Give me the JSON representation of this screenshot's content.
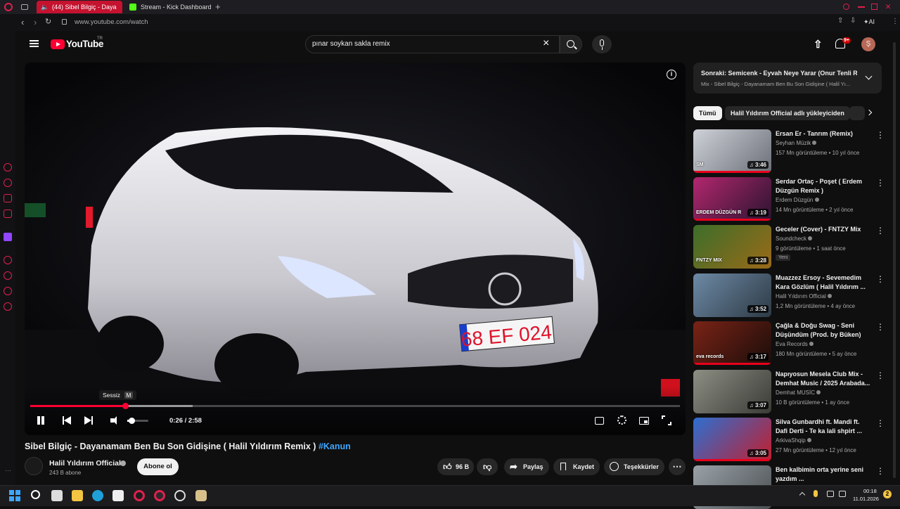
{
  "browser": {
    "tabs": [
      {
        "label": "(44) Sibel Bilgiç - Daya",
        "active": true
      },
      {
        "label": "Stream - Kick Dashboard",
        "active": false
      }
    ],
    "url": "www.youtube.com/watch",
    "ai_label": "AI"
  },
  "header": {
    "logo_text": "YouTube",
    "logo_region": "TR",
    "search_value": "pınar soykan sakla remix",
    "notification_count": "9+",
    "avatar_letter": "Ş"
  },
  "player": {
    "tooltip_label": "Sessiz",
    "tooltip_key": "M",
    "time": "0:26 / 2:58",
    "progress_fraction": 0.146,
    "volume_fraction": 0.2,
    "plate_text": "68 EF 024"
  },
  "video": {
    "title": "Sibel Bilgiç - Dayanamam Ben Bu Son Gidişine ( Halil Yıldırım Remix )",
    "hashtag": "#Kanun",
    "channel": "Halil Yıldırım Official",
    "subscribers": "243 B abone",
    "subscribe_label": "Abone ol",
    "likes": "96 B",
    "share_label": "Paylaş",
    "save_label": "Kaydet",
    "thanks_label": "Teşekkürler"
  },
  "upnext": {
    "title": "Sonraki: Semicenk - Eyvah Neye Yarar (Onur Tenli R...",
    "subtitle": "Mix - Sibel Bilgiç - Dayanamam Ben Bu Son Gidişine ( Halil Yı..."
  },
  "chips": [
    "Tümü",
    "Halil Yıldırım Official adlı yükleyiciden"
  ],
  "recommendations": [
    {
      "title": "Ersan Er - Tanrım (Remix)",
      "channel": "Seyhan Müzik",
      "meta": "157 Mn görüntüleme • 10 yıl önce",
      "duration": "3:46",
      "thumb_overlay": "SM",
      "thumb_colors": [
        "#cfd2d8",
        "#6b6f78"
      ],
      "watched": 1.0
    },
    {
      "title": "Serdar Ortaç - Poşet ( Erdem Düzgün Remix )",
      "channel": "Erdem Düzgün",
      "meta": "14 Mn görüntüleme • 2 yıl önce",
      "duration": "3:19",
      "thumb_overlay": "ERDEM DÜZGÜN R",
      "thumb_colors": [
        "#b3276e",
        "#2a1430"
      ],
      "watched": 1.0
    },
    {
      "title": "Geceler (Cover) - FNTZY Mix",
      "channel": "Soundcheck",
      "meta": "9 görüntüleme • 1 saat önce",
      "badge": "Yeni",
      "duration": "3:28",
      "thumb_overlay": "FNTZY MIX",
      "thumb_colors": [
        "#3c6e2a",
        "#9b6a18"
      ],
      "watched": 0
    },
    {
      "title": "Muazzez Ersoy - Sevemedim Kara Gözlüm ( Halil Yıldırım ...",
      "channel": "Halil Yıldırım Official",
      "meta": "1,2 Mn görüntüleme • 4 ay önce",
      "duration": "3:52",
      "thumb_overlay": "",
      "thumb_colors": [
        "#6d8aa6",
        "#2e3a45"
      ],
      "watched": 0
    },
    {
      "title": "Çağla & Doğu Swag - Seni Düşündüm (Prod. by Büken)",
      "channel": "Eva Records",
      "meta": "180 Mn görüntüleme • 5 ay önce",
      "duration": "3:17",
      "thumb_overlay": "eva records",
      "thumb_colors": [
        "#7a2316",
        "#1a0d0a"
      ],
      "watched": 1.0
    },
    {
      "title": "Napıyosun Mesela Club Mix - Demhat Music / 2025 Arabada...",
      "channel": "Demhat MUSİC",
      "meta": "10 B görüntüleme • 1 ay önce",
      "duration": "3:07",
      "thumb_overlay": "",
      "thumb_colors": [
        "#8d8f84",
        "#3a3b36"
      ],
      "watched": 0
    },
    {
      "title": "Silva Gunbardhi ft. Mandi ft. Dafi Derti - Te ka lali shpirt ...",
      "channel": "ArkivaShqip",
      "meta": "27 Mn görüntüleme • 12 yıl önce",
      "duration": "3:05",
      "thumb_overlay": "",
      "thumb_colors": [
        "#2c6fd1",
        "#c21f2e"
      ],
      "watched": 1.0
    },
    {
      "title": "Ben kalbimin orta yerine seni yazdım ...",
      "channel": "",
      "meta": "",
      "duration": "",
      "thumb_overlay": "",
      "thumb_colors": [
        "#9aa2a8",
        "#4a4f52"
      ],
      "watched": 0
    }
  ],
  "taskbar": {
    "time": "00:18",
    "date": "11.01.2026",
    "notif_count": "2"
  }
}
